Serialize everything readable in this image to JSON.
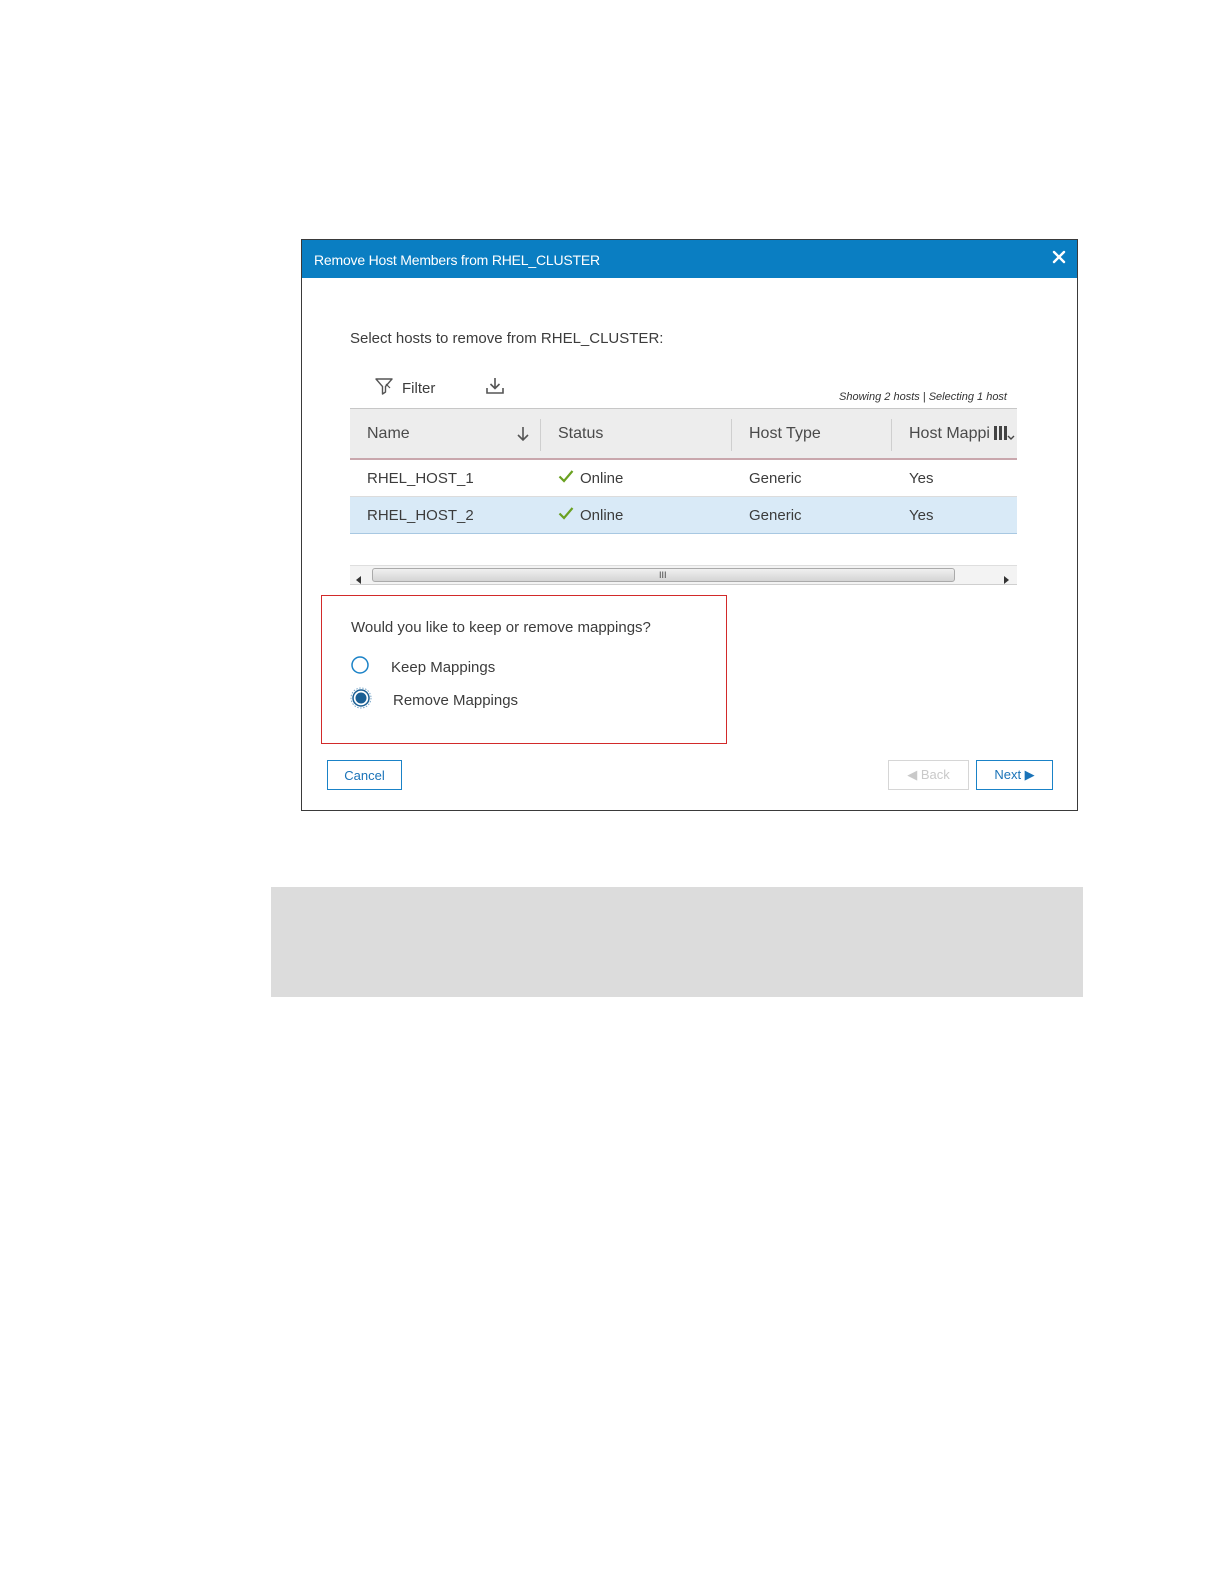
{
  "dialog": {
    "title": "Remove Host Members from RHEL_CLUSTER",
    "prompt": "Select hosts to remove from RHEL_CLUSTER:"
  },
  "toolbar": {
    "filter_label": "Filter",
    "showing_text": "Showing 2 hosts | Selecting 1 host"
  },
  "table": {
    "columns": [
      "Name",
      "Status",
      "Host Type",
      "Host Mappi"
    ],
    "rows": [
      {
        "name": "RHEL_HOST_1",
        "status": "Online",
        "host_type": "Generic",
        "host_mappings": "Yes",
        "selected": false
      },
      {
        "name": "RHEL_HOST_2",
        "status": "Online",
        "host_type": "Generic",
        "host_mappings": "Yes",
        "selected": true
      }
    ],
    "scroll_grip": "III"
  },
  "mappings": {
    "question": "Would you like to keep or remove mappings?",
    "options": [
      {
        "label": "Keep Mappings",
        "selected": false
      },
      {
        "label": "Remove Mappings",
        "selected": true
      }
    ]
  },
  "footer": {
    "cancel_label": "Cancel",
    "back_label": "◀ Back",
    "next_label": "Next ▶"
  },
  "colors": {
    "title_bar": "#0a7ec2",
    "selected_row": "#d9eaf7",
    "highlight_box": "#d22a2a",
    "check": "#6aa121"
  }
}
